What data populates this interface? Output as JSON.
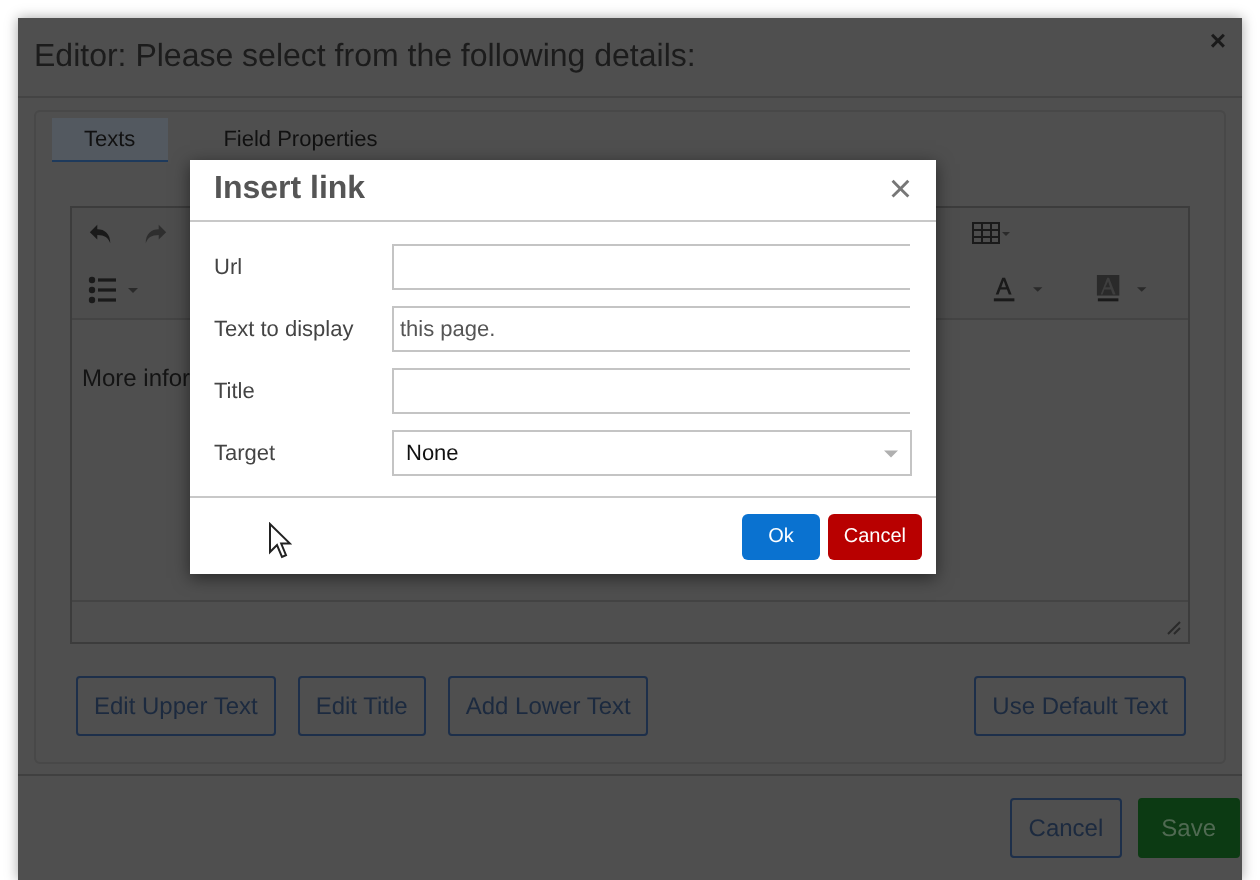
{
  "window": {
    "title": "Editor: Please select from the following details:",
    "close": "×"
  },
  "tabs": [
    {
      "label": "Texts",
      "selected": true
    },
    {
      "label": "Field Properties",
      "selected": false
    }
  ],
  "editor": {
    "content": "More infor"
  },
  "actions": [
    "Edit Upper Text",
    "Edit Title",
    "Add Lower Text",
    "Use Default Text"
  ],
  "footer_buttons": [
    {
      "label": "Cancel",
      "kind": "outline"
    },
    {
      "label": "Save",
      "kind": "primary"
    }
  ],
  "dialog": {
    "title": "Insert link",
    "close": "×",
    "fields": [
      {
        "label": "Url",
        "kind": "text"
      },
      {
        "label": "Text to display",
        "kind": "text",
        "value": "this page."
      },
      {
        "label": "Title",
        "kind": "text"
      },
      {
        "label": "Target",
        "kind": "select",
        "value": "None"
      }
    ],
    "buttons": [
      {
        "label": "Ok",
        "kind": "primary"
      },
      {
        "label": "Cancel",
        "kind": "danger"
      }
    ]
  }
}
